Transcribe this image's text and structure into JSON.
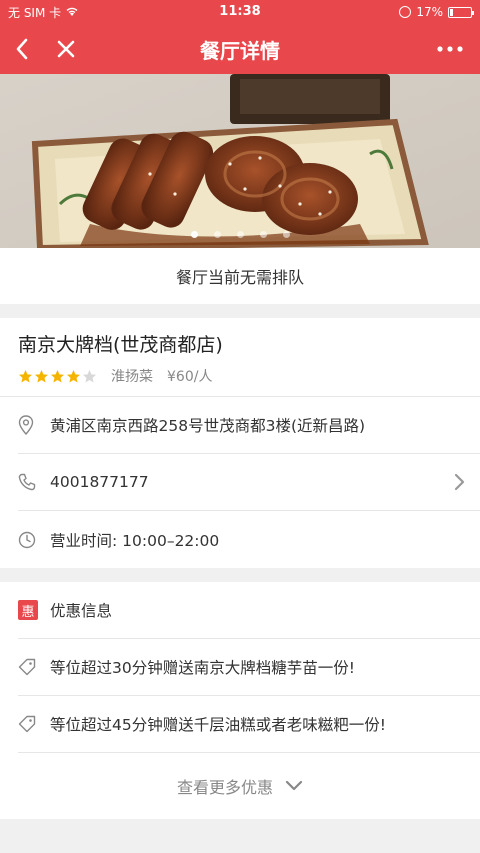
{
  "status": {
    "carrier": "无 SIM 卡",
    "time": "11:38",
    "battery": "17%",
    "battery_level": 0.17
  },
  "header": {
    "title": "餐厅详情",
    "bg_color": "#e8484c"
  },
  "banner": {
    "image_icon": "braised-lotus-root-photo",
    "slide_count": 5,
    "active_slide": 0
  },
  "queue_status": "餐厅当前无需排队",
  "restaurant": {
    "name": "南京大牌档(世茂商都店)",
    "rating": 4,
    "rating_max": 5,
    "cuisine": "淮扬菜",
    "price": "¥60/人",
    "address": "黄浦区南京西路258号世茂商都3楼(近新昌路)",
    "phone": "4001877177",
    "hours": "营业时间: 10:00–22:00"
  },
  "promotions": {
    "badge": "惠",
    "title": "优惠信息",
    "items": [
      "等位超过30分钟赠送南京大牌档糖芋苗一份!",
      "等位超过45分钟赠送千层油糕或者老味糍粑一份!"
    ],
    "more_label": "查看更多优惠"
  },
  "colors": {
    "accent": "#e8484c",
    "star": "#f5b400",
    "star_empty": "#d8d8d8"
  }
}
